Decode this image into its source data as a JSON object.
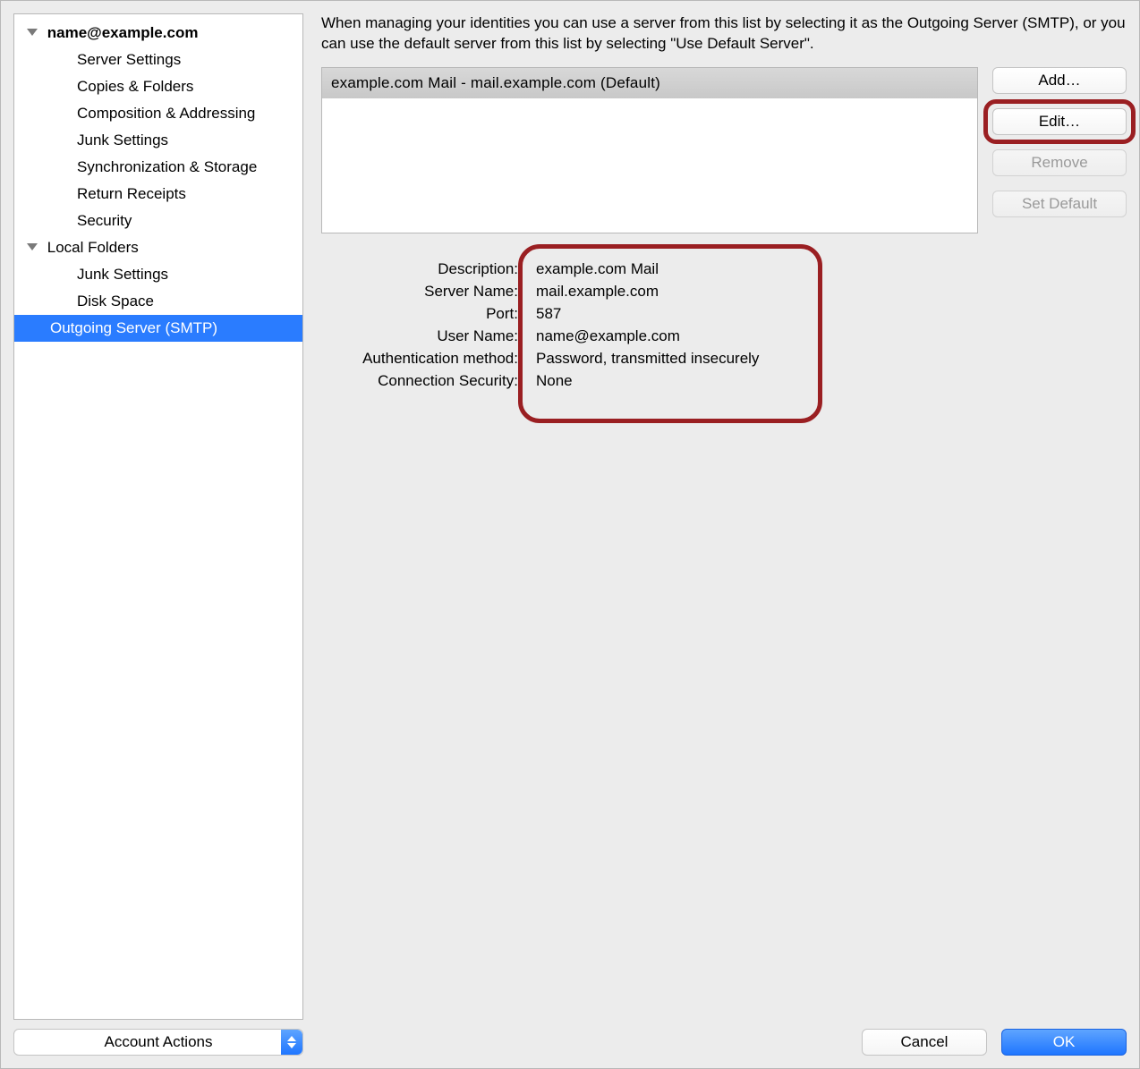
{
  "sidebar": {
    "account1": {
      "label": "name@example.com",
      "items": [
        "Server Settings",
        "Copies & Folders",
        "Composition & Addressing",
        "Junk Settings",
        "Synchronization & Storage",
        "Return Receipts",
        "Security"
      ]
    },
    "localFolders": {
      "label": "Local Folders",
      "items": [
        "Junk Settings",
        "Disk Space"
      ]
    },
    "outgoing": "Outgoing Server (SMTP)",
    "accountActions": "Account Actions"
  },
  "main": {
    "intro": "When managing your identities you can use a server from this list by selecting it as the Outgoing Server (SMTP), or you can use the default server from this list by selecting \"Use Default Server\".",
    "serverListItem": "example.com Mail -  mail.example.com (Default)",
    "buttons": {
      "add": "Add…",
      "edit": "Edit…",
      "remove": "Remove",
      "setDefault": "Set Default"
    },
    "details": {
      "labels": {
        "description": "Description:",
        "serverName": "Server Name:",
        "port": "Port:",
        "userName": "User Name:",
        "authMethod": "Authentication method:",
        "connSecurity": "Connection Security:"
      },
      "values": {
        "description": "example.com Mail",
        "serverName": "mail.example.com",
        "port": "587",
        "userName": "name@example.com",
        "authMethod": "Password, transmitted insecurely",
        "connSecurity": "None"
      }
    }
  },
  "footer": {
    "cancel": "Cancel",
    "ok": "OK"
  }
}
